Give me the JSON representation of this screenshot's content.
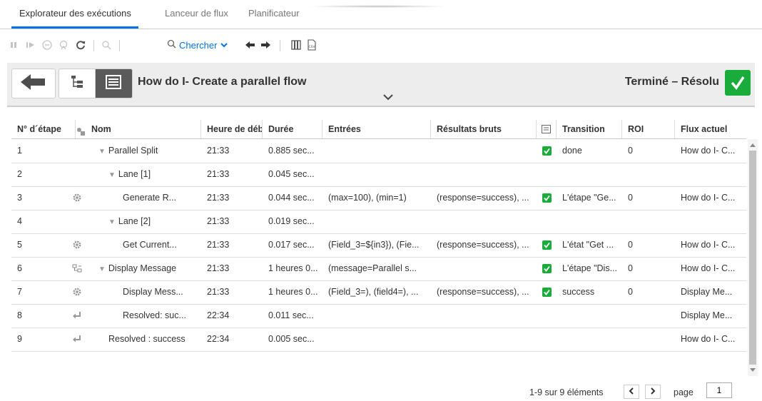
{
  "tabs": [
    {
      "label": "Explorateur des exécutions",
      "active": true
    },
    {
      "label": "Lanceur de flux",
      "active": false
    },
    {
      "label": "Planificateur",
      "active": false
    }
  ],
  "toolbar": {
    "search_label": "Chercher",
    "icons": [
      "pause-icon",
      "resume-icon",
      "cancel-icon",
      "reassign-icon",
      "refresh-icon",
      "filter-icon",
      "search-icon",
      "prev-icon",
      "next-icon",
      "columns-icon",
      "csv-export-icon"
    ]
  },
  "header": {
    "flow_title": "How do I- Create a parallel flow",
    "status": "Terminé – Résolu",
    "accent": "#0073e7",
    "success_color": "#1aac3a"
  },
  "table": {
    "columns": [
      "N° d´étape",
      "Nom",
      "Heure de début",
      "Durée",
      "Entrées",
      "Résultats bruts",
      "Transition",
      "ROI",
      "Flux actuel"
    ],
    "rows": [
      {
        "step": "1",
        "icon": "",
        "indent": 1,
        "expand": true,
        "name": "Parallel Split",
        "start": "21:33",
        "duration": "0.885 sec...",
        "inputs": "",
        "raw": "",
        "checked": true,
        "transition": "done",
        "roi": "0",
        "flow": "How do I- C..."
      },
      {
        "step": "2",
        "icon": "",
        "indent": 2,
        "expand": true,
        "name": "Lane [1]",
        "start": "21:33",
        "duration": "0.045 sec...",
        "inputs": "",
        "raw": "",
        "checked": false,
        "transition": "",
        "roi": "",
        "flow": ""
      },
      {
        "step": "3",
        "icon": "gear",
        "indent": 3,
        "expand": false,
        "name": "Generate R...",
        "start": "21:33",
        "duration": "0.044 sec...",
        "inputs": "(max=100), (min=1)",
        "raw": "(response=success), ...",
        "checked": true,
        "transition": "L'étape \"Ge...",
        "roi": "0",
        "flow": "How do I- C..."
      },
      {
        "step": "4",
        "icon": "",
        "indent": 2,
        "expand": true,
        "name": "Lane [2]",
        "start": "21:33",
        "duration": "0.019 sec...",
        "inputs": "",
        "raw": "",
        "checked": false,
        "transition": "",
        "roi": "",
        "flow": ""
      },
      {
        "step": "5",
        "icon": "gear",
        "indent": 3,
        "expand": false,
        "name": "Get Current...",
        "start": "21:33",
        "duration": "0.017 sec...",
        "inputs": "(Field_3=${in3}), (Fie...",
        "raw": "(response=success), ...",
        "checked": true,
        "transition": "L'état \"Get ...",
        "roi": "0",
        "flow": "How do I- C..."
      },
      {
        "step": "6",
        "icon": "subflow",
        "indent": 1,
        "expand": true,
        "name": "Display Message",
        "start": "21:33",
        "duration": "1 heures 0...",
        "inputs": "(message=Parallel s...",
        "raw": "",
        "checked": true,
        "transition": "L'étape \"Dis...",
        "roi": "0",
        "flow": "How do I- C..."
      },
      {
        "step": "7",
        "icon": "gear",
        "indent": 3,
        "expand": false,
        "name": "Display Mess...",
        "start": "21:33",
        "duration": "1 heures 0...",
        "inputs": "(Field_3=), (field4=), ...",
        "raw": "(response=success), ...",
        "checked": true,
        "transition": "success",
        "roi": "0",
        "flow": "Display Me..."
      },
      {
        "step": "8",
        "icon": "return",
        "indent": 3,
        "expand": false,
        "name": "Resolved: suc...",
        "start": "22:34",
        "duration": "0.011 sec...",
        "inputs": "",
        "raw": "",
        "checked": false,
        "transition": "",
        "roi": "",
        "flow": "Display Me..."
      },
      {
        "step": "9",
        "icon": "return",
        "indent": 2,
        "expand": false,
        "name": "Resolved : success",
        "start": "22:34",
        "duration": "0.005 sec...",
        "inputs": "",
        "raw": "",
        "checked": false,
        "transition": "",
        "roi": "",
        "flow": "How do I- C..."
      }
    ]
  },
  "pagination": {
    "summary": "1-9 sur 9 éléments",
    "page_label": "page",
    "page_value": "1"
  }
}
